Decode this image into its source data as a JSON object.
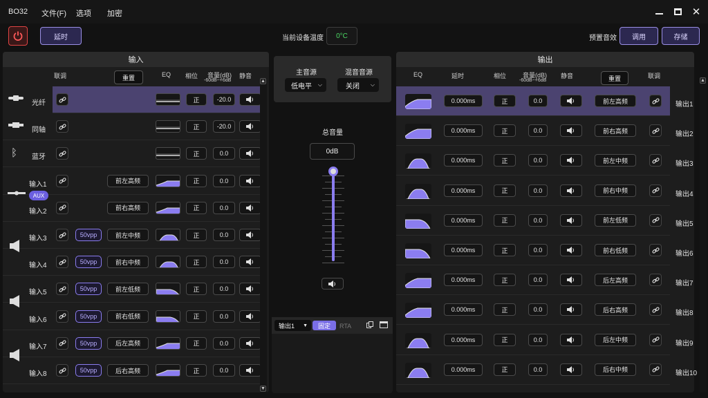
{
  "app": {
    "title": "BO32"
  },
  "menu": [
    "文件(F)",
    "选项",
    "加密"
  ],
  "toolbar": {
    "delay_label": "延时",
    "temp_label": "当前设备温度",
    "temp_value": "0°C",
    "preset_label": "预置音效",
    "load_label": "调用",
    "save_label": "存储"
  },
  "input": {
    "title": "输入",
    "headers": {
      "link": "联调",
      "reset": "重置",
      "eq": "EQ",
      "phase": "相位",
      "vol": "音量(dB)",
      "vol_range": "-60dB~+6dB",
      "mute": "静音"
    },
    "aux_badge": "AUX",
    "rows": [
      {
        "name": "光纤",
        "vpp": "",
        "source": "",
        "phase": "正",
        "vol": "-20.0",
        "selected": true
      },
      {
        "name": "同轴",
        "vpp": "",
        "source": "",
        "phase": "正",
        "vol": "-20.0",
        "selected": false
      },
      {
        "name": "蓝牙",
        "vpp": "",
        "source": "",
        "phase": "正",
        "vol": "0.0",
        "selected": false
      },
      {
        "name": "输入1",
        "vpp": "",
        "source": "前左高频",
        "phase": "正",
        "vol": "0.0",
        "selected": false
      },
      {
        "name": "输入2",
        "vpp": "",
        "source": "前右高频",
        "phase": "正",
        "vol": "0.0",
        "selected": false
      },
      {
        "name": "输入3",
        "vpp": "50vpp",
        "source": "前左中频",
        "phase": "正",
        "vol": "0.0",
        "selected": false
      },
      {
        "name": "输入4",
        "vpp": "50vpp",
        "source": "前右中频",
        "phase": "正",
        "vol": "0.0",
        "selected": false
      },
      {
        "name": "输入5",
        "vpp": "50vpp",
        "source": "前左低频",
        "phase": "正",
        "vol": "0.0",
        "selected": false
      },
      {
        "name": "输入6",
        "vpp": "50vpp",
        "source": "前右低频",
        "phase": "正",
        "vol": "0.0",
        "selected": false
      },
      {
        "name": "输入7",
        "vpp": "50vpp",
        "source": "后左高频",
        "phase": "正",
        "vol": "0.0",
        "selected": false
      },
      {
        "name": "输入8",
        "vpp": "50vpp",
        "source": "后右高频",
        "phase": "正",
        "vol": "0.0",
        "selected": false
      }
    ]
  },
  "center": {
    "main_source_label": "主音源",
    "main_source_value": "低电平",
    "mix_source_label": "混音音源",
    "mix_source_value": "关闭",
    "master_label": "总音量",
    "master_value": "0dB",
    "master_level": 1.0,
    "rta": {
      "channel": "输出1",
      "fixed_label": "固定",
      "rta_label": "RTA"
    }
  },
  "output": {
    "title": "输出",
    "headers": {
      "eq": "EQ",
      "delay": "延时",
      "phase": "相位",
      "vol": "音量(dB)",
      "vol_range": "-60dB~+6dB",
      "mute": "静音",
      "reset": "重置",
      "link": "联调"
    },
    "rows": [
      {
        "name": "输出1",
        "delay": "0.000ms",
        "phase": "正",
        "vol": "0.0",
        "assign": "前左高频",
        "eq": "hp",
        "selected": true
      },
      {
        "name": "输出2",
        "delay": "0.000ms",
        "phase": "正",
        "vol": "0.0",
        "assign": "前右高频",
        "eq": "hp",
        "selected": false
      },
      {
        "name": "输出3",
        "delay": "0.000ms",
        "phase": "正",
        "vol": "0.0",
        "assign": "前左中频",
        "eq": "bp",
        "selected": false
      },
      {
        "name": "输出4",
        "delay": "0.000ms",
        "phase": "正",
        "vol": "0.0",
        "assign": "前右中频",
        "eq": "bp",
        "selected": false
      },
      {
        "name": "输出5",
        "delay": "0.000ms",
        "phase": "正",
        "vol": "0.0",
        "assign": "前左低频",
        "eq": "lp",
        "selected": false
      },
      {
        "name": "输出6",
        "delay": "0.000ms",
        "phase": "正",
        "vol": "0.0",
        "assign": "前右低频",
        "eq": "lp",
        "selected": false
      },
      {
        "name": "输出7",
        "delay": "0.000ms",
        "phase": "正",
        "vol": "0.0",
        "assign": "后左高频",
        "eq": "hp",
        "selected": false
      },
      {
        "name": "输出8",
        "delay": "0.000ms",
        "phase": "正",
        "vol": "0.0",
        "assign": "后右高频",
        "eq": "hp",
        "selected": false
      },
      {
        "name": "输出9",
        "delay": "0.000ms",
        "phase": "正",
        "vol": "0.0",
        "assign": "后左中频",
        "eq": "bp",
        "selected": false
      },
      {
        "name": "输出10",
        "delay": "0.000ms",
        "phase": "正",
        "vol": "0.0",
        "assign": "后右中频",
        "eq": "bp",
        "selected": false
      }
    ]
  },
  "colors": {
    "accent": "#7a6ee6",
    "selected_row": "#4b4370",
    "temp": "#4cd964",
    "power": "#e04444"
  }
}
